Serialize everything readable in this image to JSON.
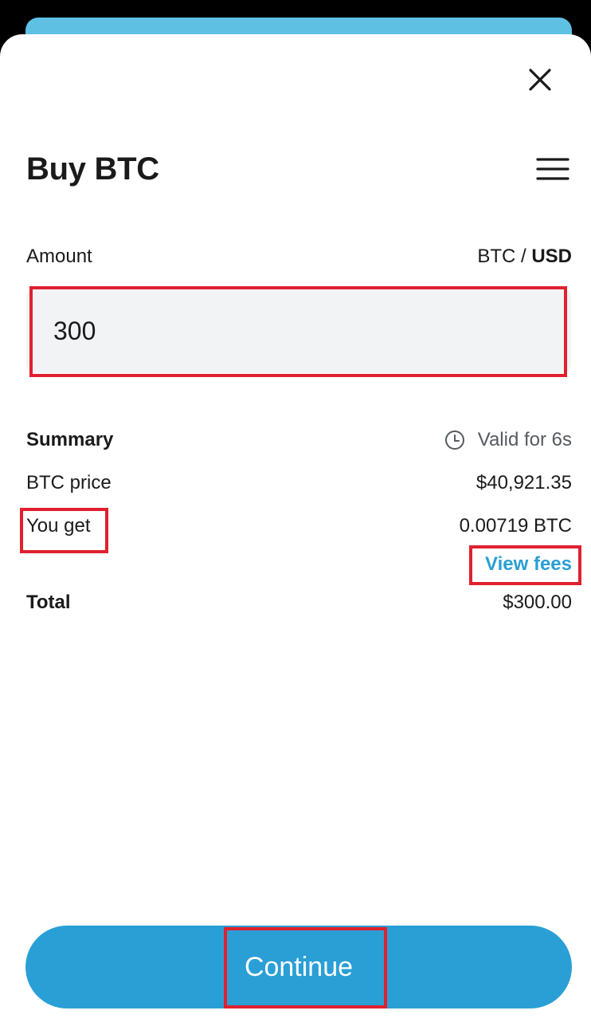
{
  "header": {
    "title": "Buy BTC",
    "close_icon": "close-icon",
    "menu_icon": "hamburger-menu-icon"
  },
  "amount": {
    "label": "Amount",
    "currency_option_1": "BTC",
    "currency_separator": " / ",
    "currency_option_2": "USD",
    "selected_currency": "USD",
    "value": "300"
  },
  "summary": {
    "label": "Summary",
    "valid_text": "Valid for 6s",
    "valid_icon": "clock-icon",
    "btc_price_label": "BTC price",
    "btc_price_value": "$40,921.35",
    "you_get_label": "You get",
    "you_get_value": "0.00719 BTC",
    "view_fees_label": "View fees",
    "total_label": "Total",
    "total_value": "$300.00"
  },
  "actions": {
    "continue_label": "Continue"
  },
  "colors": {
    "accent": "#2a9fd6",
    "highlight": "#e0202f",
    "input_bg": "#f2f3f5"
  }
}
